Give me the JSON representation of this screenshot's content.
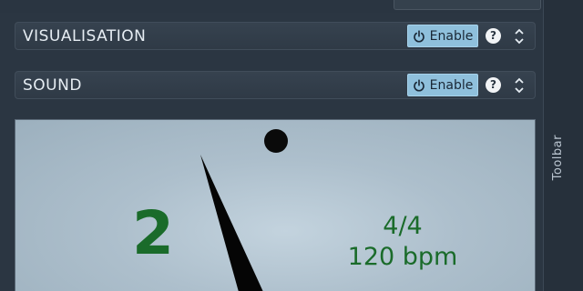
{
  "sections": [
    {
      "title": "VISUALISATION",
      "enable_label": "Enable",
      "help": "?"
    },
    {
      "title": "SOUND",
      "enable_label": "Enable",
      "help": "?"
    }
  ],
  "toolbar": {
    "label": "Toolbar"
  },
  "metronome": {
    "beat": "2",
    "time_signature": "4/4",
    "tempo": "120 bpm"
  },
  "colors": {
    "background": "#2b3642",
    "enable_button": "#8fc0dc",
    "display_text": "#1a6b2a",
    "display_bg": "#adbfcc"
  },
  "icons": [
    "power-icon",
    "help-icon",
    "updown-icon"
  ]
}
